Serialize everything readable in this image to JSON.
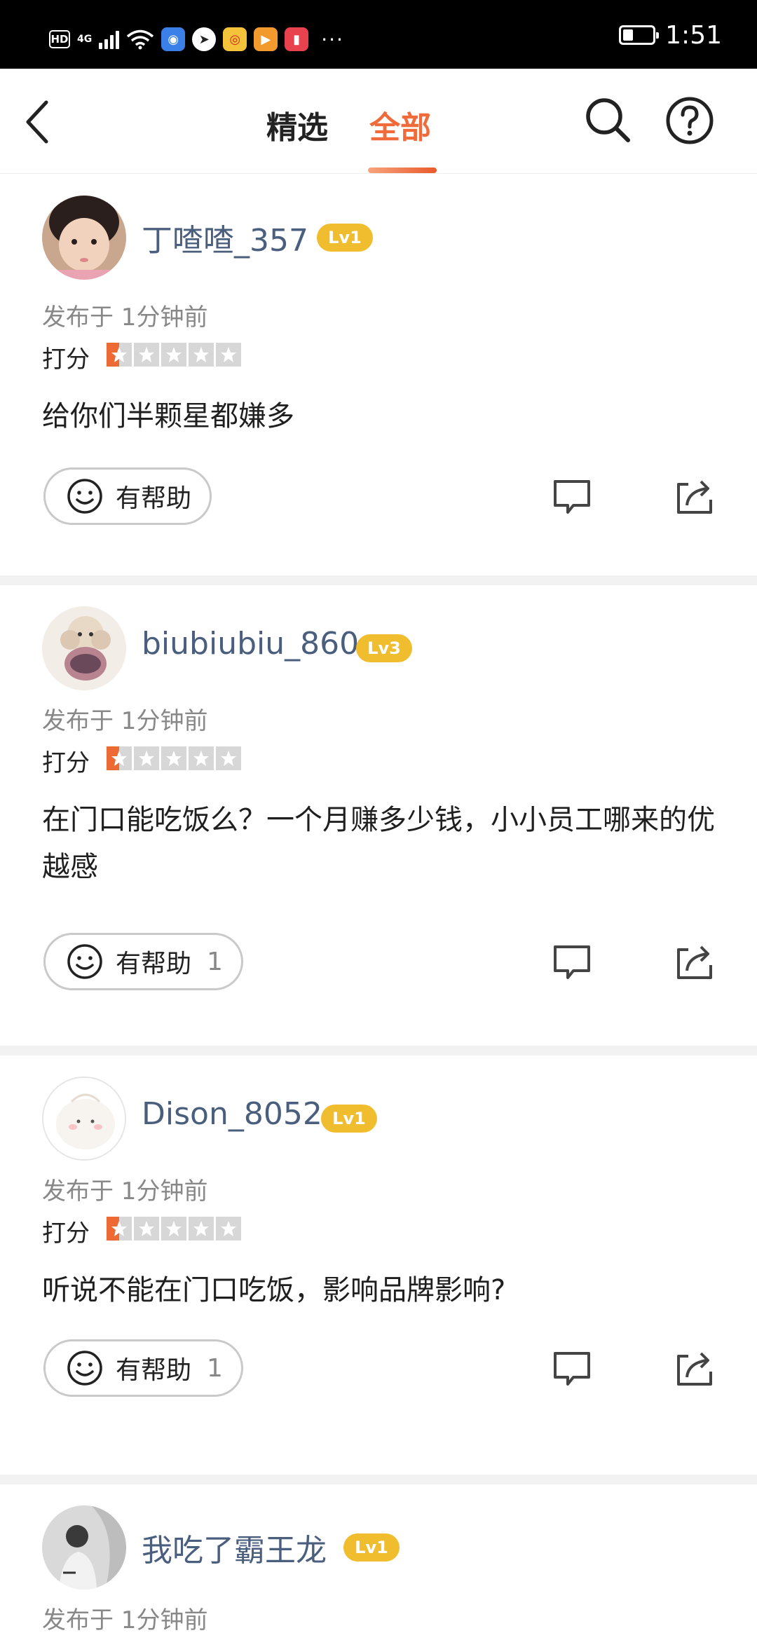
{
  "status_bar": {
    "hd": "HD",
    "network": "4G",
    "time": "1:51",
    "battery_level": 0.35,
    "app_icons": [
      "browser-icon",
      "bird-icon",
      "weibo-icon",
      "video-icon",
      "book-icon"
    ],
    "more": "···"
  },
  "header": {
    "tabs": [
      {
        "label": "精选",
        "active": false
      },
      {
        "label": "全部",
        "active": true
      }
    ],
    "accent_color": "#f16b3a"
  },
  "reviews": [
    {
      "username": "丁喳喳_357",
      "level": "Lv1",
      "posted": "发布于 1分钟前",
      "rating_label": "打分",
      "rating": 0.5,
      "text": "给你们半颗星都嫌多",
      "helpful_label": "有帮助",
      "helpful_count": ""
    },
    {
      "username": "biubiubiu_860",
      "level": "Lv3",
      "posted": "发布于 1分钟前",
      "rating_label": "打分",
      "rating": 0.5,
      "text": "在门口能吃饭么？一个月赚多少钱，小小员工哪来的优越感",
      "helpful_label": "有帮助",
      "helpful_count": "1"
    },
    {
      "username": "Dison_8052",
      "level": "Lv1",
      "posted": "发布于 1分钟前",
      "rating_label": "打分",
      "rating": 0.5,
      "text": "听说不能在门口吃饭，影响品牌影响?",
      "helpful_label": "有帮助",
      "helpful_count": "1"
    },
    {
      "username": "我吃了霸王龙",
      "level": "Lv1",
      "posted": "发布于 1分钟前"
    }
  ]
}
